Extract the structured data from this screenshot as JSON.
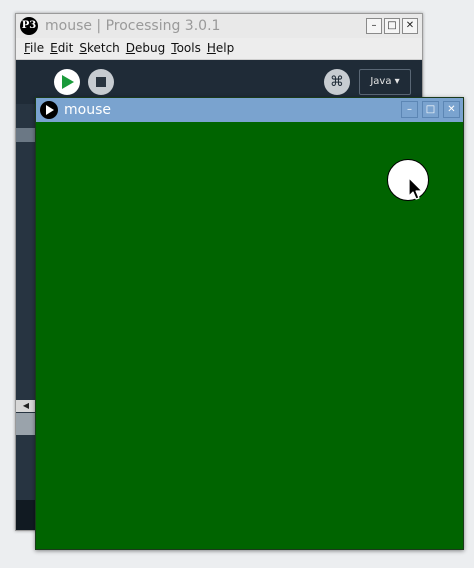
{
  "ide": {
    "logo_glyph": "P3",
    "title": "mouse | Processing 3.0.1",
    "window_buttons": {
      "minimize": "–",
      "maximize": "□",
      "close": "✕"
    },
    "menu": [
      "File",
      "Edit",
      "Sketch",
      "Debug",
      "Tools",
      "Help"
    ],
    "toolbar": {
      "debug_glyph": "⌘",
      "mode_label": "Java ▾"
    },
    "gutter_arrow": "◀"
  },
  "sketch": {
    "title": "mouse",
    "window_buttons": {
      "minimize": "–",
      "maximize": "□",
      "close": "✕"
    },
    "canvas_color": "#006400",
    "circle_color": "#ffffff"
  },
  "colors": {
    "ide_background": "#1f2b37",
    "sketch_titlebar": "#7aa3cf"
  },
  "icons": [
    "processing-logo-icon",
    "run-icon",
    "stop-icon",
    "debug-icon",
    "mouse-cursor-icon"
  ]
}
